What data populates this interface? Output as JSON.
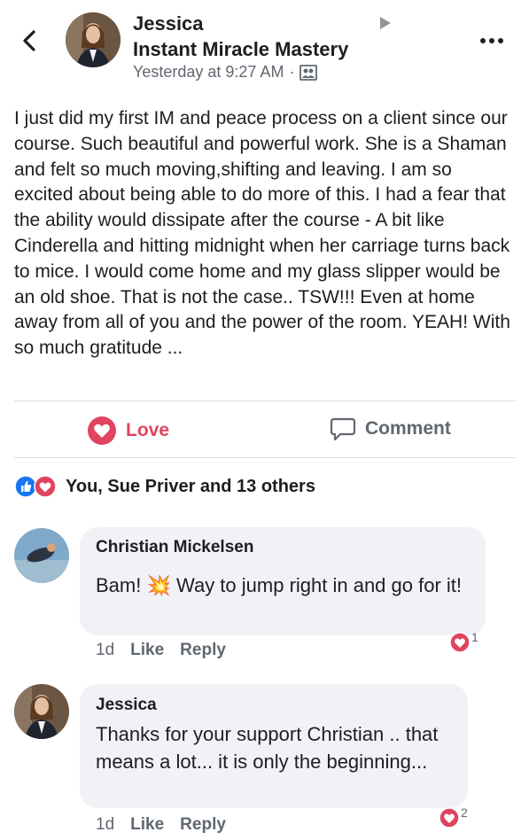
{
  "post": {
    "author": "Jessica",
    "group": "Instant Miracle Mastery",
    "timestamp": "Yesterday at 9:27 AM",
    "separator": "·",
    "audience_icon": "group-audience-icon",
    "body": "I just did my first IM and peace process on a client since our course. Such beautiful and powerful work. She is a Shaman and felt so much moving,shifting and leaving.  I am so excited about being able to do more of this. I had a fear that the ability would dissipate after the course - A bit like Cinderella and hitting midnight when her carriage turns back to mice. I would come home and my glass slipper would be an old shoe. That is not the case.. TSW!!! Even at home away from all of you and the power of the room. YEAH! With so much gratitude ..."
  },
  "actions": {
    "love_label": "Love",
    "comment_label": "Comment"
  },
  "reactions": {
    "summary": "You, Sue Priver and 13 others"
  },
  "comments": [
    {
      "name": "Christian Mickelsen",
      "text_before": "Bam!",
      "emoji": "💥",
      "text_after": "Way to jump right in and go for it!",
      "age": "1d",
      "like_label": "Like",
      "reply_label": "Reply",
      "reaction_count": "1"
    },
    {
      "name": "Jessica",
      "text": "Thanks for your support Christian .. that means a lot... it is only the beginning...",
      "age": "1d",
      "like_label": "Like",
      "reply_label": "Reply",
      "reaction_count": "2"
    }
  ],
  "colors": {
    "love": "#e0445f",
    "like_blue": "#1877f2",
    "text": "#1c1e21",
    "secondary": "#606770",
    "bubble": "#f0f2f5"
  }
}
